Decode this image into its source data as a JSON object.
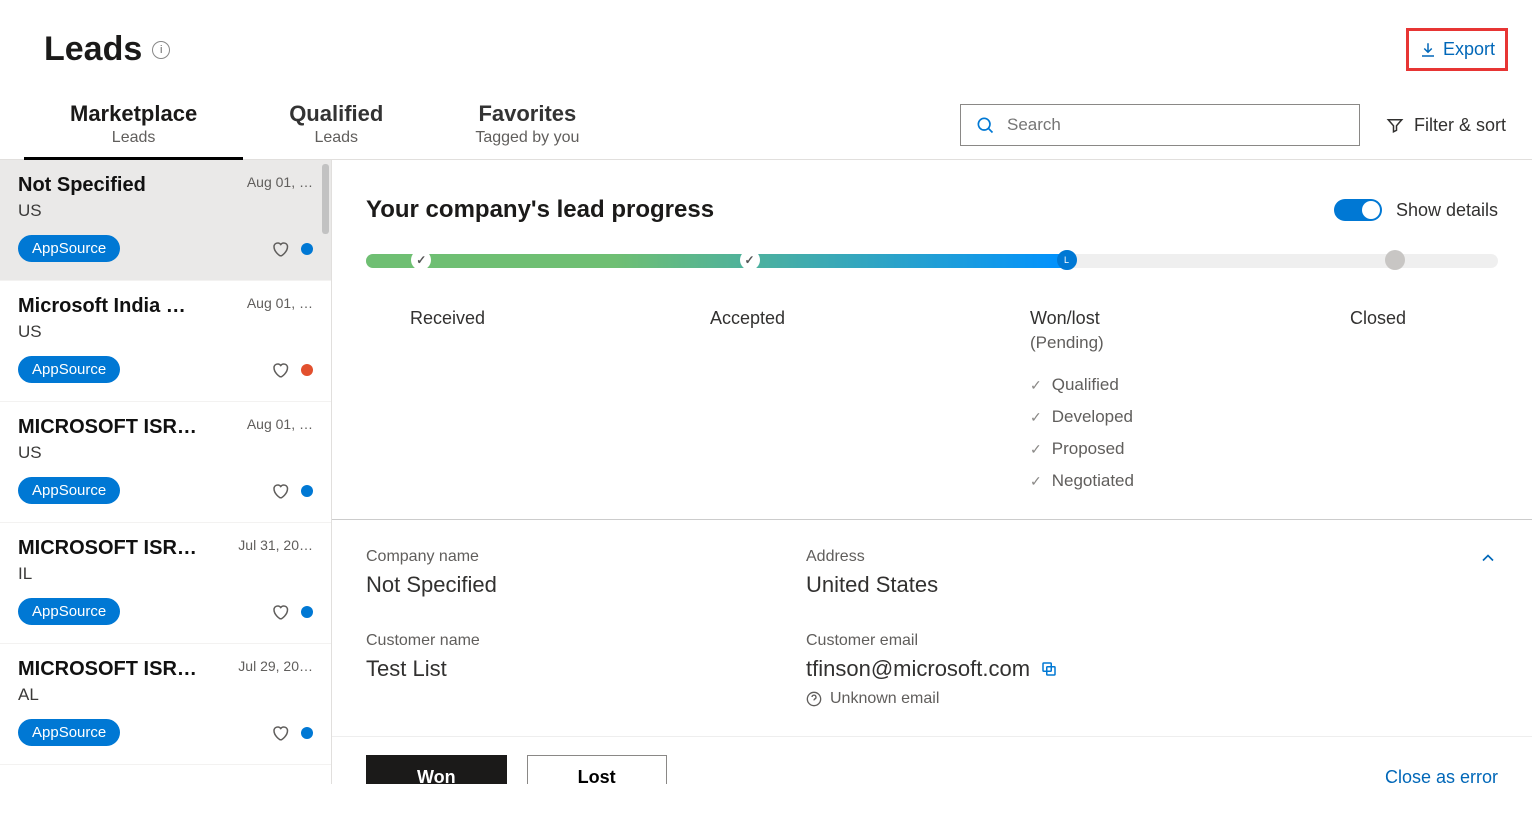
{
  "header": {
    "title": "Leads",
    "export_label": "Export"
  },
  "tabs": [
    {
      "title": "Marketplace",
      "subtitle": "Leads"
    },
    {
      "title": "Qualified",
      "subtitle": "Leads"
    },
    {
      "title": "Favorites",
      "subtitle": "Tagged by you"
    }
  ],
  "search": {
    "placeholder": "Search"
  },
  "filter_sort_label": "Filter & sort",
  "list": [
    {
      "title": "Not Specified",
      "date": "Aug 01, …",
      "sub": "US",
      "pill": "AppSource",
      "dot": "blue"
    },
    {
      "title": "Microsoft India R&…",
      "date": "Aug 01, …",
      "sub": "US",
      "pill": "AppSource",
      "dot": "orange"
    },
    {
      "title": "MICROSOFT ISRAE…",
      "date": "Aug 01, …",
      "sub": "US",
      "pill": "AppSource",
      "dot": "blue"
    },
    {
      "title": "MICROSOFT ISRAE…",
      "date": "Jul 31, 20…",
      "sub": "IL",
      "pill": "AppSource",
      "dot": "blue"
    },
    {
      "title": "MICROSOFT ISRAE…",
      "date": "Jul 29, 20…",
      "sub": "AL",
      "pill": "AppSource",
      "dot": "blue"
    }
  ],
  "progress": {
    "heading": "Your company's lead progress",
    "toggle_label": "Show details",
    "stages": {
      "s1": "Received",
      "s2": "Accepted",
      "s3": "Won/lost",
      "s3sub": "(Pending)",
      "s4": "Closed"
    },
    "substeps": [
      "Qualified",
      "Developed",
      "Proposed",
      "Negotiated"
    ]
  },
  "details": {
    "company_name_label": "Company name",
    "company_name": "Not Specified",
    "address_label": "Address",
    "address": "United States",
    "customer_name_label": "Customer name",
    "customer_name": "Test List",
    "customer_email_label": "Customer email",
    "customer_email": "tfinson@microsoft.com",
    "unknown_email": "Unknown email"
  },
  "actions": {
    "won": "Won",
    "lost": "Lost",
    "close_error": "Close as error"
  }
}
